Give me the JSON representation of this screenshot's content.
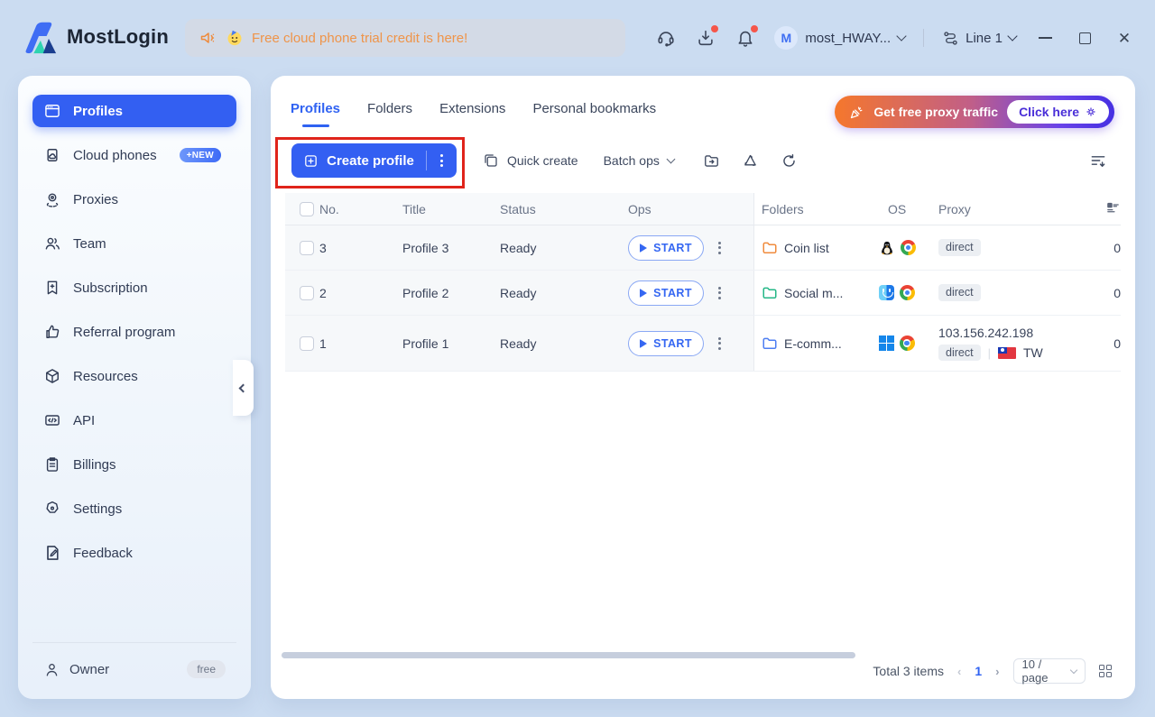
{
  "window": {
    "brand": "MostLogin",
    "banner_text": "Free cloud phone trial credit is here!",
    "account_name": "most_HWAY...",
    "avatar_initial": "M",
    "line_label": "Line 1",
    "close_glyph": "✕"
  },
  "sidebar": {
    "items": [
      {
        "label": "Profiles",
        "active": true
      },
      {
        "label": "Cloud phones",
        "badge": "+NEW"
      },
      {
        "label": "Proxies"
      },
      {
        "label": "Team"
      },
      {
        "label": "Subscription"
      },
      {
        "label": "Referral program"
      },
      {
        "label": "Resources"
      },
      {
        "label": "API"
      },
      {
        "label": "Billings"
      },
      {
        "label": "Settings"
      },
      {
        "label": "Feedback"
      }
    ],
    "owner": {
      "label": "Owner",
      "badge": "free"
    }
  },
  "main": {
    "tabs": [
      {
        "label": "Profiles",
        "active": true
      },
      {
        "label": "Folders"
      },
      {
        "label": "Extensions"
      },
      {
        "label": "Personal bookmarks"
      }
    ],
    "promo": {
      "label": "Get free proxy traffic",
      "cta": "Click here"
    },
    "toolbar": {
      "create": "Create profile",
      "quick": "Quick create",
      "batch": "Batch ops"
    },
    "table": {
      "headers": {
        "no": "No.",
        "title": "Title",
        "status": "Status",
        "ops": "Ops",
        "folders": "Folders",
        "os": "OS",
        "proxy": "Proxy"
      },
      "rows": [
        {
          "no": "3",
          "title": "Profile 3",
          "status": "Ready",
          "start": "START",
          "folder": "Coin list",
          "folder_color": "#f08b3d",
          "os": "Linux",
          "browser": "Chrome",
          "proxy_type": "direct",
          "count": "0"
        },
        {
          "no": "2",
          "title": "Profile 2",
          "status": "Ready",
          "start": "START",
          "folder": "Social m...",
          "folder_color": "#25b787",
          "os": "macOS",
          "browser": "Chrome",
          "proxy_type": "direct",
          "count": "0"
        },
        {
          "no": "1",
          "title": "Profile 1",
          "status": "Ready",
          "start": "START",
          "folder": "E-comm...",
          "folder_color": "#4d7ef2",
          "os": "Windows",
          "browser": "Chrome",
          "proxy_ip": "103.156.242.198",
          "proxy_type": "direct",
          "region": "TW",
          "count": "0"
        }
      ]
    },
    "pagination": {
      "total": "Total 3 items",
      "prev": "‹",
      "page": "1",
      "next": "›",
      "page_size": "10 / page"
    }
  },
  "colors": {
    "accent_blue": "#335ff2",
    "annotation_red": "#e0241b",
    "banner_orange": "#ef9449",
    "promo_gradient_start": "#f5772c",
    "promo_gradient_end": "#4630e2",
    "folder_orange": "#f08b3d",
    "folder_green": "#25b787",
    "folder_blue": "#4d7ef2",
    "page_background": "#cbdcf1"
  }
}
